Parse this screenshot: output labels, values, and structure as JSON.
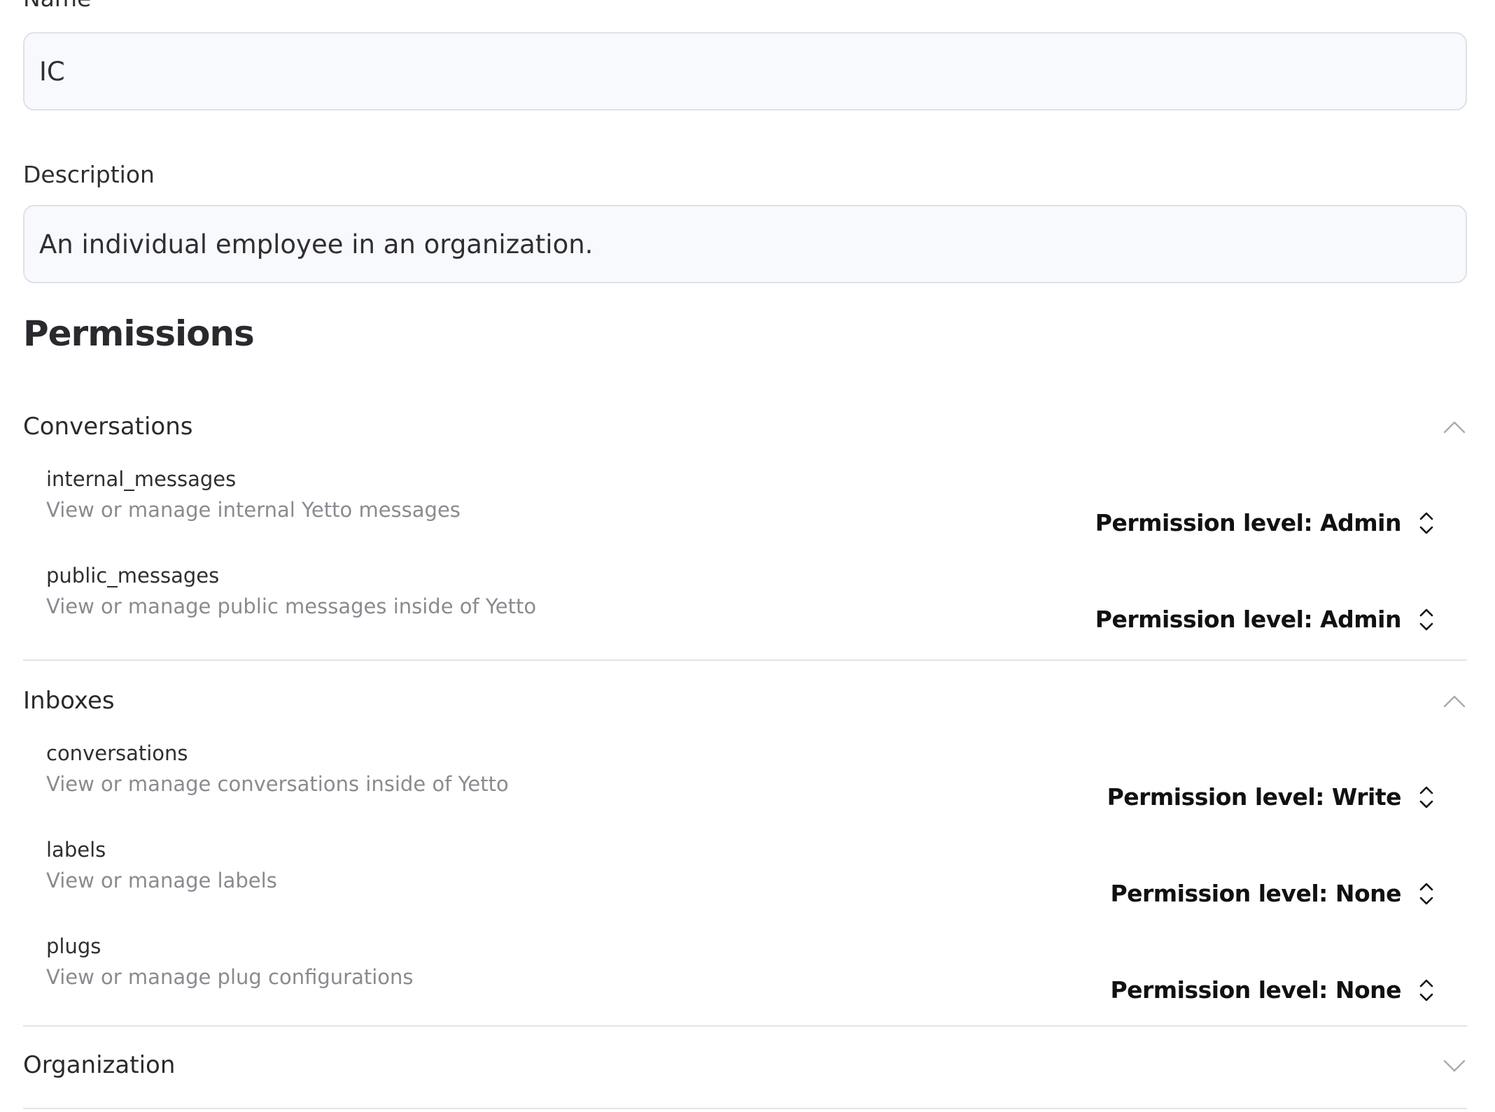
{
  "form": {
    "name_label": "Name *",
    "name_value": "IC",
    "description_label": "Description",
    "description_value": "An individual employee in an organization."
  },
  "permissions": {
    "title": "Permissions",
    "groups": [
      {
        "title": "Conversations",
        "expanded": true,
        "chevron_icon": "chevron-up-icon",
        "items": [
          {
            "name": "internal_messages",
            "description": "View or manage internal Yetto messages",
            "level_label": "Permission level: Admin"
          },
          {
            "name": "public_messages",
            "description": "View or manage public messages inside of Yetto",
            "level_label": "Permission level: Admin"
          }
        ]
      },
      {
        "title": "Inboxes",
        "expanded": true,
        "chevron_icon": "chevron-up-icon",
        "items": [
          {
            "name": "conversations",
            "description": "View or manage conversations inside of Yetto",
            "level_label": "Permission level: Write"
          },
          {
            "name": "labels",
            "description": "View or manage labels",
            "level_label": "Permission level: None"
          },
          {
            "name": "plugs",
            "description": "View or manage plug configurations",
            "level_label": "Permission level: None"
          }
        ]
      },
      {
        "title": "Organization",
        "expanded": false,
        "chevron_icon": "chevron-down-icon",
        "items": []
      }
    ]
  },
  "colors": {
    "input_bg": "#f8f9fd",
    "input_border": "#dfe1ea",
    "muted_text": "#8a8b90",
    "divider": "#e3e4ea"
  }
}
